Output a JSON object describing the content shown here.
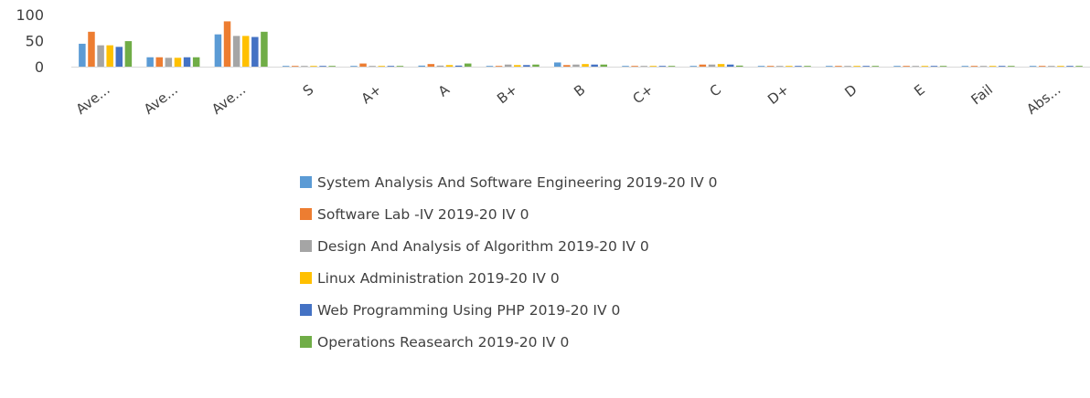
{
  "chart_data": {
    "type": "bar",
    "categories": [
      "Ave...",
      "Ave...",
      "Ave...",
      "S",
      "A+",
      "A",
      "B+",
      "B",
      "C+",
      "C",
      "D+",
      "D",
      "E",
      "Fail",
      "Abs..."
    ],
    "series": [
      {
        "name": "System Analysis And Software Engineering  2019-20 IV 0",
        "color": "#5B9BD5",
        "values": [
          44,
          18,
          62,
          0,
          0,
          2,
          0,
          8,
          0,
          1,
          0,
          0,
          0,
          0,
          0
        ]
      },
      {
        "name": "Software Lab -IV 2019-20 IV 0",
        "color": "#ED7D31",
        "values": [
          67,
          18,
          87,
          1,
          6,
          5,
          0,
          3,
          0,
          4,
          0,
          0,
          0,
          0,
          0
        ]
      },
      {
        "name": "Design And Analysis of Algorithm 2019-20 IV 0",
        "color": "#A5A5A5",
        "values": [
          41,
          17,
          59,
          0,
          1,
          2,
          4,
          4,
          0,
          4,
          0,
          1,
          0,
          1,
          0
        ]
      },
      {
        "name": "Linux Administration 2019-20 IV 0",
        "color": "#FFC000",
        "values": [
          41,
          17,
          59,
          0,
          0,
          3,
          3,
          5,
          0,
          5,
          0,
          1,
          0,
          0,
          0
        ]
      },
      {
        "name": "Web Programming Using PHP 2019-20 IV 0",
        "color": "#4472C4",
        "values": [
          38,
          18,
          57,
          0,
          0,
          2,
          3,
          4,
          0,
          4,
          0,
          0,
          0,
          0,
          0
        ]
      },
      {
        "name": "Operations Reasearch 2019-20 IV 0",
        "color": "#70AD47",
        "values": [
          49,
          18,
          67,
          0,
          0,
          6,
          4,
          4,
          0,
          2,
          0,
          0,
          0,
          0,
          0
        ]
      }
    ],
    "yticks": [
      0,
      50,
      100
    ],
    "ylim": [
      0,
      100
    ],
    "grid": false,
    "legend": "bottom"
  }
}
